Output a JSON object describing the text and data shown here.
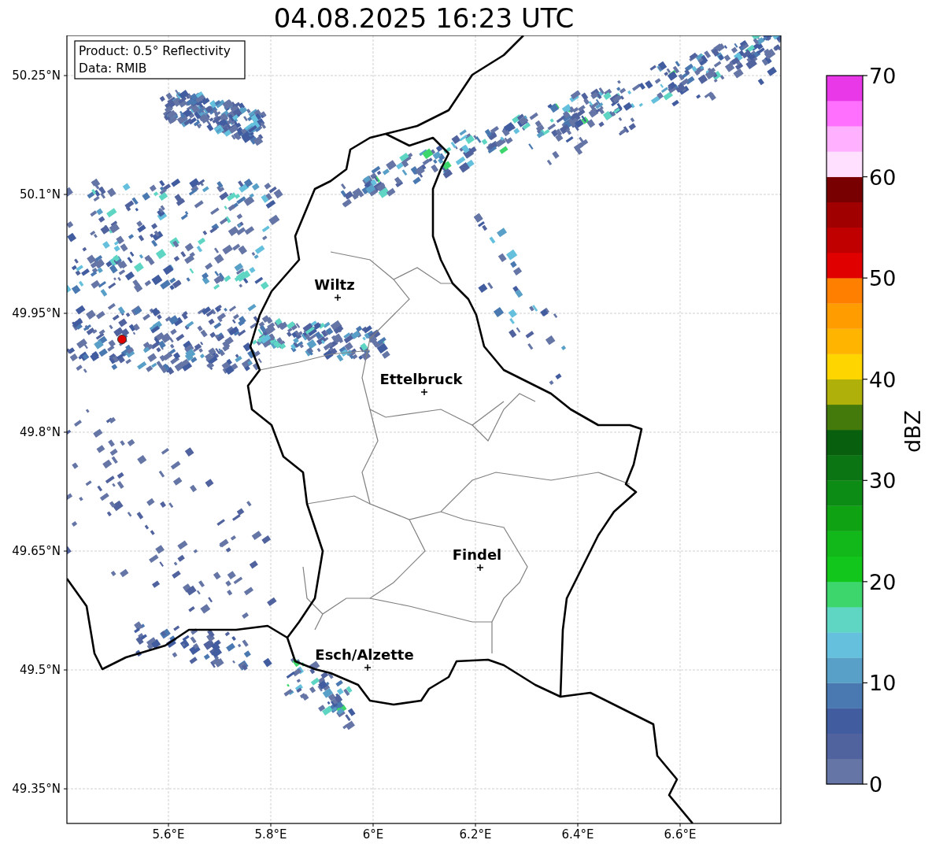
{
  "title": "04.08.2025 16:23 UTC",
  "info": [
    "Product: 0.5° Reflectivity",
    "Data: RMIB"
  ],
  "y_ticks": [
    "50.25°N",
    "50.1°N",
    "49.95°N",
    "49.8°N",
    "49.65°N",
    "49.5°N",
    "49.35°N"
  ],
  "x_ticks": [
    "5.6°E",
    "5.8°E",
    "6°E",
    "6.2°E",
    "6.4°E",
    "6.6°E"
  ],
  "cities": [
    {
      "name": "Wiltz"
    },
    {
      "name": "Ettelbruck"
    },
    {
      "name": "Findel"
    },
    {
      "name": "Esch/Alzette"
    }
  ],
  "colorbar": {
    "label": "dBZ",
    "ticks": [
      "70",
      "60",
      "50",
      "40",
      "30",
      "20",
      "10",
      "0"
    ],
    "bands": [
      {
        "color": "#6475a6"
      },
      {
        "color": "#51639e"
      },
      {
        "color": "#425ca0"
      },
      {
        "color": "#4a78b0"
      },
      {
        "color": "#58a0c8"
      },
      {
        "color": "#64c0dc"
      },
      {
        "color": "#5fd6c4"
      },
      {
        "color": "#3dd66c"
      },
      {
        "color": "#13c61c"
      },
      {
        "color": "#12b81a"
      },
      {
        "color": "#0fa314"
      },
      {
        "color": "#0c8c14"
      },
      {
        "color": "#0a7512"
      },
      {
        "color": "#08600f"
      },
      {
        "color": "#447a0c"
      },
      {
        "color": "#b0b00a"
      },
      {
        "color": "#ffd500"
      },
      {
        "color": "#ffb400"
      },
      {
        "color": "#ff9c00"
      },
      {
        "color": "#ff7f00"
      },
      {
        "color": "#e00000"
      },
      {
        "color": "#c00000"
      },
      {
        "color": "#a00000"
      },
      {
        "color": "#780000"
      },
      {
        "color": "#ffe0ff"
      },
      {
        "color": "#ffb0ff"
      },
      {
        "color": "#ff70ff"
      },
      {
        "color": "#e838e8"
      }
    ]
  }
}
